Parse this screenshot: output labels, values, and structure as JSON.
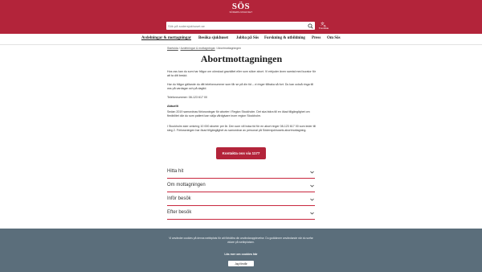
{
  "header": {
    "logo_mark": "SÖS",
    "logo_sub": "SÖDERSJUKHUSET",
    "search_placeholder": "Sök på sodersjukhuset.se",
    "translate_label": "Translate"
  },
  "nav": {
    "items": [
      {
        "label": "Avdelningar & mottagningar",
        "active": true
      },
      {
        "label": "Besöka sjukhuset"
      },
      {
        "label": "Jobba på Sös"
      },
      {
        "label": "Forskning & utbildning"
      },
      {
        "label": "Press"
      },
      {
        "label": "Om Sös"
      }
    ]
  },
  "breadcrumb": {
    "items": [
      "Startsida",
      "Avdelningar & mottagningar",
      "Abortmottagningen"
    ],
    "separator": "/"
  },
  "page": {
    "title": "Abortmottagningen",
    "intro1": "Hos oss kan du som har frågor om oönskad graviditet eller som söker abort. Vi erbjuder även samtal med kurator för att ta ditt beslut.",
    "intro2": "Har du frågor gällande du ditt telefonnummer som får se på din tid – vi ringer tillbaka så fort. Du kan också ringa till oss på vardagar och på dagtid.",
    "phone": "Telefonnummer: 08-123 617 00",
    "subheading": "Aktuellt",
    "body1": "Sedan 2019 samordnas förlossningar för aborter i Region Stockholm. Det ska bidra till en ökad tillgänglighet om flexibilitet där du som patient kan välja vårdgivare inom region Stockholm.",
    "body2": "I Stockholm sker omkring 10 000 aborter per år. Den som vill boka tid för en abort ringer 08-123 617 00 som leder till steg 2. Förlossningen har ökad tillgänglighet av samordnar av personal på Södersjukhusets abortmottagning.",
    "cta_label": "Kontakta oss via 1177"
  },
  "accordion": [
    {
      "label": "Hitta hit"
    },
    {
      "label": "Om mottagningen"
    },
    {
      "label": "Inför besök"
    },
    {
      "label": "Efter besök"
    }
  ],
  "cookie": {
    "text": "Vi använder cookies på denna webbplats för att förbättra din användarupplevelse. Du godkänner användande när du surfar vidare på webbplatsen.",
    "link_label": "Läs mer om cookies här",
    "button_label": "Jag förstår"
  },
  "colors": {
    "brand_red": "#b3243a",
    "cookie_bg": "#5b6e7b"
  },
  "icons": {
    "search": "search-icon",
    "translate": "translate-icon",
    "accordion": "chevron-down-icon"
  }
}
